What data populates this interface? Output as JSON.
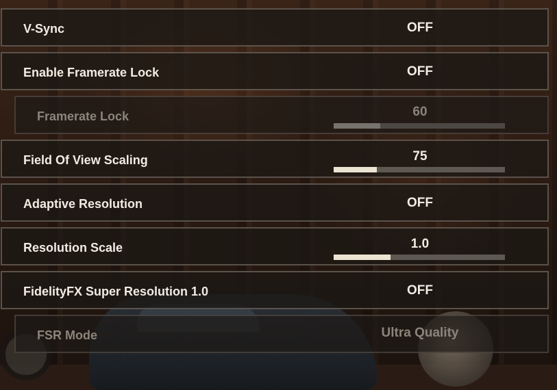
{
  "settings": [
    {
      "label": "V-Sync",
      "value": "OFF",
      "type": "toggle",
      "indent": false,
      "disabled": false
    },
    {
      "label": "Enable Framerate Lock",
      "value": "OFF",
      "type": "toggle",
      "indent": false,
      "disabled": false
    },
    {
      "label": "Framerate Lock",
      "value": "60",
      "type": "slider",
      "fill": 0.27,
      "indent": true,
      "disabled": true
    },
    {
      "label": "Field Of View Scaling",
      "value": "75",
      "type": "slider",
      "fill": 0.25,
      "indent": false,
      "disabled": false
    },
    {
      "label": "Adaptive Resolution",
      "value": "OFF",
      "type": "toggle",
      "indent": false,
      "disabled": false
    },
    {
      "label": "Resolution Scale",
      "value": "1.0",
      "type": "slider",
      "fill": 0.33,
      "indent": false,
      "disabled": false
    },
    {
      "label": "FidelityFX Super Resolution 1.0",
      "value": "OFF",
      "type": "toggle",
      "indent": false,
      "disabled": false
    },
    {
      "label": "FSR Mode",
      "value": "Ultra Quality",
      "type": "select",
      "indent": true,
      "disabled": true
    }
  ],
  "colors": {
    "slider_fill": "#ece4d2",
    "slider_track": "#5d5852",
    "text": "#f1ece3",
    "disabled_text": "#8c847b"
  }
}
